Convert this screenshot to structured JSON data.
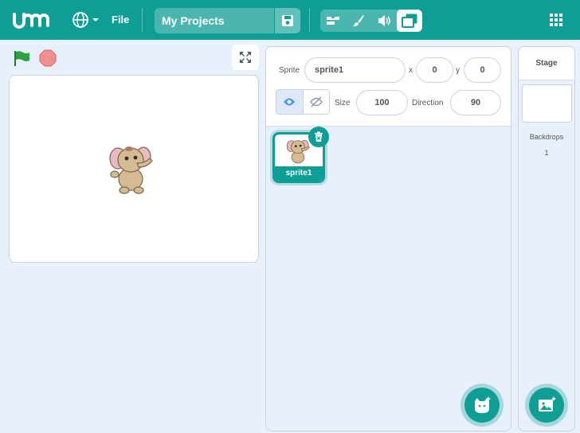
{
  "header": {
    "menu_file": "File",
    "project_title": "My Projects",
    "modes": [
      "code",
      "costumes",
      "sounds",
      "backdrop-editor"
    ],
    "active_mode": 3
  },
  "stage_controls": {
    "flag_color": "#2ea043",
    "stop_color": "#ef8f8f"
  },
  "sprite_info": {
    "sprite_label": "Sprite",
    "sprite_name": "sprite1",
    "x_label": "x",
    "x_value": "0",
    "y_label": "y",
    "y_value": "0",
    "size_label": "Size",
    "size_value": "100",
    "direction_label": "Direction",
    "direction_value": "90"
  },
  "sprites": [
    {
      "name": "sprite1",
      "selected": true
    }
  ],
  "stage_panel": {
    "title": "Stage",
    "backdrops_label": "Backdrops",
    "backdrops_count": "1"
  },
  "colors": {
    "accent": "#0f9e95",
    "background": "#e8f0fb"
  }
}
